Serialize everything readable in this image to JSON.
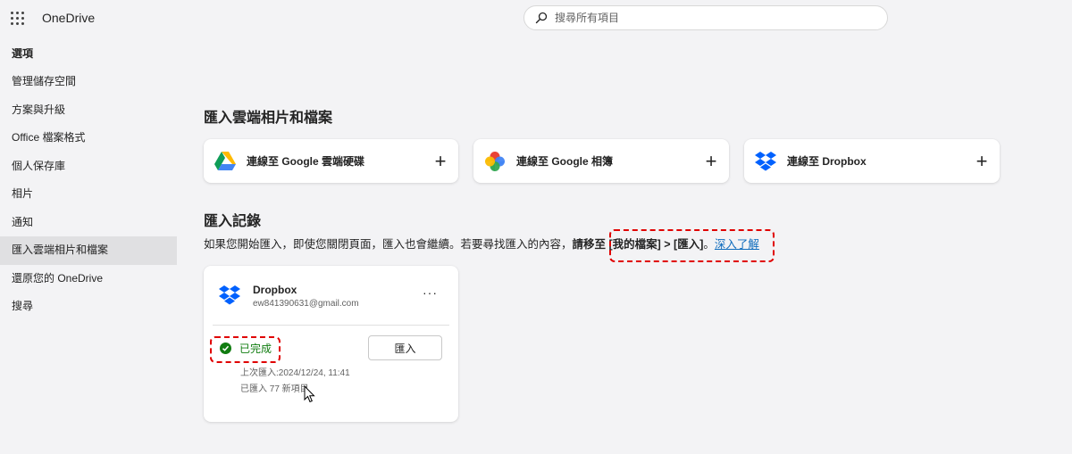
{
  "app": {
    "title": "OneDrive"
  },
  "search": {
    "placeholder": "搜尋所有項目"
  },
  "sidebar": {
    "heading": "選項",
    "items": [
      {
        "label": "管理儲存空間"
      },
      {
        "label": "方案與升級"
      },
      {
        "label": "Office 檔案格式"
      },
      {
        "label": "個人保存庫"
      },
      {
        "label": "相片"
      },
      {
        "label": "通知"
      },
      {
        "label": "匯入雲端相片和檔案"
      },
      {
        "label": "還原您的 OneDrive"
      },
      {
        "label": "搜尋"
      }
    ]
  },
  "import_section": {
    "title": "匯入雲端相片和檔案",
    "cards": [
      {
        "label": "連線至 Google 雲端硬碟",
        "icon": "google-drive-icon",
        "action_icon": "plus-icon"
      },
      {
        "label": "連線至 Google 相簿",
        "icon": "google-photos-icon",
        "action_icon": "plus-icon"
      },
      {
        "label": "連線至 Dropbox",
        "icon": "dropbox-icon",
        "action_icon": "plus-icon"
      }
    ]
  },
  "history": {
    "title": "匯入記錄",
    "desc_prefix": "如果您開始匯入，即使您關閉頁面，匯入也會繼續。若要尋找匯入的內容，",
    "desc_highlight": "請移至 [我的檔案] > [匯入]",
    "desc_suffix": "。",
    "learn_more": "深入了解"
  },
  "record": {
    "service": "Dropbox",
    "email": "ew841390631@gmail.com",
    "more": "···",
    "status": "已完成",
    "import_button": "匯入",
    "last_import": "上次匯入:2024/12/24, 11:41",
    "imported_count": "已匯入 77 新項目"
  },
  "colors": {
    "success": "#107c10",
    "link": "#0f6cbd",
    "annotation": "#e00000",
    "dropbox": "#0061fe"
  }
}
